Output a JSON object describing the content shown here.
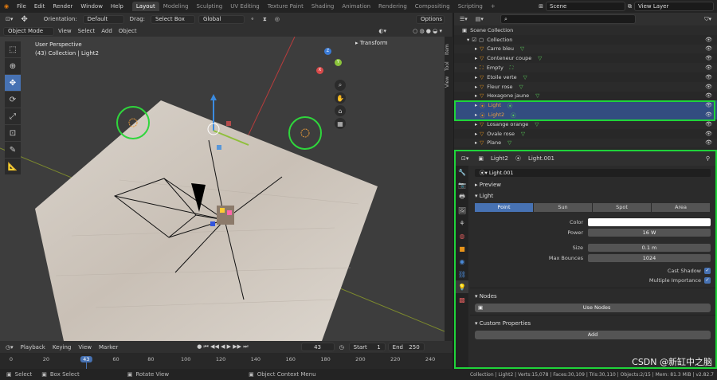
{
  "topbar": {
    "menus": [
      "File",
      "Edit",
      "Render",
      "Window",
      "Help"
    ],
    "workspaces": [
      "Layout",
      "Modeling",
      "Sculpting",
      "UV Editing",
      "Texture Paint",
      "Shading",
      "Animation",
      "Rendering",
      "Compositing",
      "Scripting"
    ],
    "active_workspace": "Layout",
    "scene": "Scene",
    "view_layer": "View Layer"
  },
  "viewport_header": {
    "orientation_label": "Orientation:",
    "orientation": "Default",
    "drag_label": "Drag:",
    "drag": "Select Box",
    "transform_orientation": "Global",
    "options": "Options",
    "mode": "Object Mode",
    "menus": [
      "View",
      "Select",
      "Add",
      "Object"
    ]
  },
  "viewport": {
    "perspective": "User Perspective",
    "collection_info": "(43) Collection | Light2",
    "transform_panel": "Transform",
    "side_tabs": [
      "Item",
      "Tool",
      "View"
    ],
    "gizmo_axes": {
      "x": "X",
      "y": "Y",
      "z": "Z"
    }
  },
  "timeline": {
    "menus": [
      "Playback",
      "Keying",
      "View",
      "Marker"
    ],
    "current_frame": "43",
    "start_label": "Start",
    "start": "1",
    "end_label": "End",
    "end": "250",
    "ticks": [
      "0",
      "20",
      "43",
      "60",
      "80",
      "100",
      "120",
      "140",
      "160",
      "180",
      "200",
      "220",
      "240"
    ]
  },
  "statusbar": {
    "select": "Select",
    "box_select": "Box Select",
    "rotate_view": "Rotate View",
    "context_menu": "Object Context Menu",
    "stats": "Collection | Light2 | Verts:15,078 | Faces:30,109 | Tris:30,110 | Objects:2/15 | Mem: 81.3 MiB | v2.82.7"
  },
  "outliner": {
    "root": "Scene Collection",
    "collection": "Collection",
    "items": [
      {
        "name": "Carre bleu",
        "type": "mesh",
        "selected": false
      },
      {
        "name": "Conteneur coupe",
        "type": "mesh",
        "selected": false
      },
      {
        "name": "Empty",
        "type": "empty",
        "selected": false
      },
      {
        "name": "Etoile verte",
        "type": "mesh",
        "selected": false
      },
      {
        "name": "Fleur rose",
        "type": "mesh",
        "selected": false
      },
      {
        "name": "Hexagone jaune",
        "type": "mesh",
        "selected": false
      },
      {
        "name": "Light",
        "type": "light",
        "selected": true
      },
      {
        "name": "Light2",
        "type": "light",
        "selected": true
      },
      {
        "name": "Losange orange",
        "type": "mesh",
        "selected": false
      },
      {
        "name": "Ovale rose",
        "type": "mesh",
        "selected": false
      },
      {
        "name": "Plane",
        "type": "mesh",
        "selected": false
      }
    ]
  },
  "properties": {
    "object": "Light2",
    "data": "Light.001",
    "datablock": "Light.001",
    "panels": {
      "preview": "Preview",
      "light": "Light",
      "nodes": "Nodes",
      "custom": "Custom Properties"
    },
    "light_types": [
      "Point",
      "Sun",
      "Spot",
      "Area"
    ],
    "active_type": "Point",
    "color_label": "Color",
    "power_label": "Power",
    "power": "16 W",
    "size_label": "Size",
    "size": "0.1 m",
    "bounces_label": "Max Bounces",
    "bounces": "1024",
    "cast_shadow": "Cast Shadow",
    "multiple_importance": "Multiple Importance",
    "use_nodes": "Use Nodes",
    "add": "Add"
  },
  "watermark": "CSDN @新缸中之脑",
  "colors": {
    "accent": "#4772b3",
    "highlight": "#1fd43a",
    "selected_row": "#334d80"
  }
}
